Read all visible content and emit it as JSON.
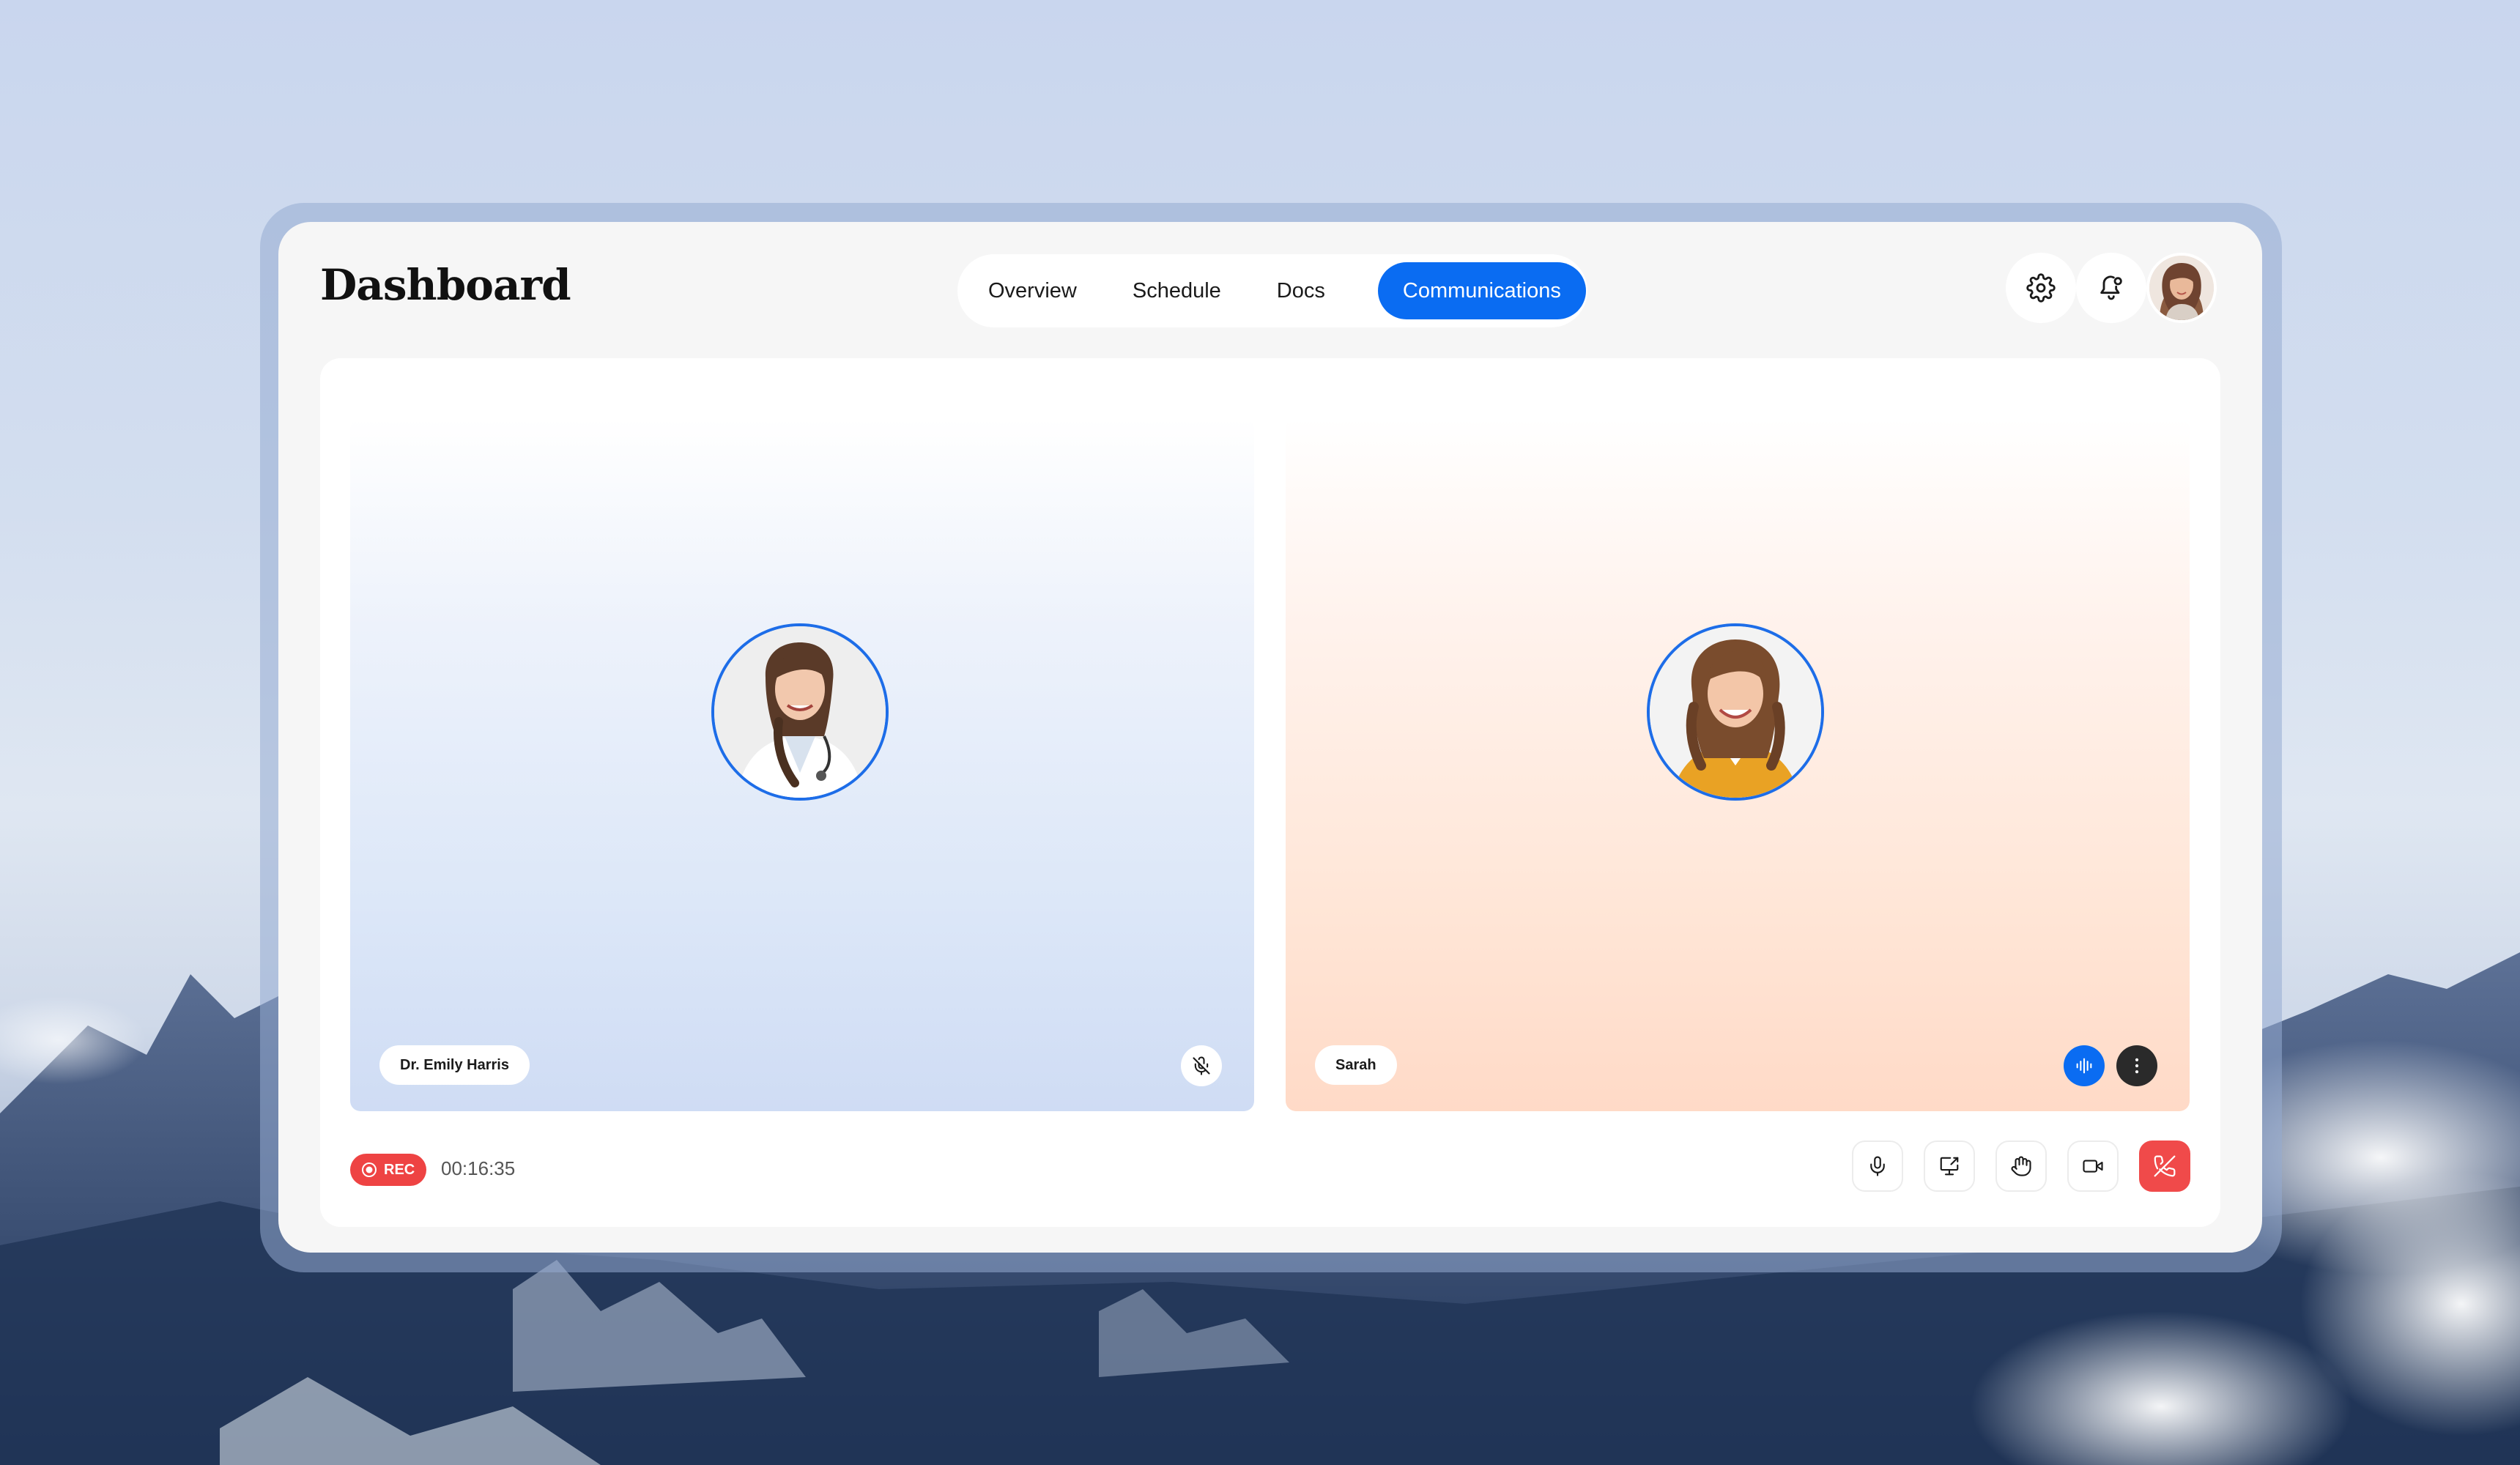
{
  "app": {
    "title": "Dashboard"
  },
  "nav": {
    "tabs": [
      {
        "label": "Overview"
      },
      {
        "label": "Schedule"
      },
      {
        "label": "Docs"
      },
      {
        "label": "Communications",
        "active": true
      }
    ]
  },
  "header": {
    "icons": [
      "settings-gear-icon",
      "notification-bell-icon"
    ],
    "user_avatar": "user-avatar"
  },
  "call": {
    "participants": [
      {
        "name": "Dr. Emily Harris",
        "status_icon": "mic-muted-icon",
        "ring_color": "#1d6de8"
      },
      {
        "name": "Sarah",
        "status_icon": "audio-wave-icon",
        "menu_icon": "more-vertical-icon",
        "ring_color": "#1d6de8"
      }
    ],
    "recording": {
      "label": "REC",
      "elapsed": "00:16:35"
    },
    "controls": [
      {
        "icon": "microphone-icon"
      },
      {
        "icon": "screen-share-icon"
      },
      {
        "icon": "raise-hand-icon"
      },
      {
        "icon": "video-camera-icon"
      },
      {
        "icon": "end-call-icon"
      }
    ]
  },
  "colors": {
    "accent": "#0a6cf2",
    "danger": "#f04a4a",
    "tile_left": "#d8e3f7",
    "tile_right": "#ffe2d1"
  }
}
